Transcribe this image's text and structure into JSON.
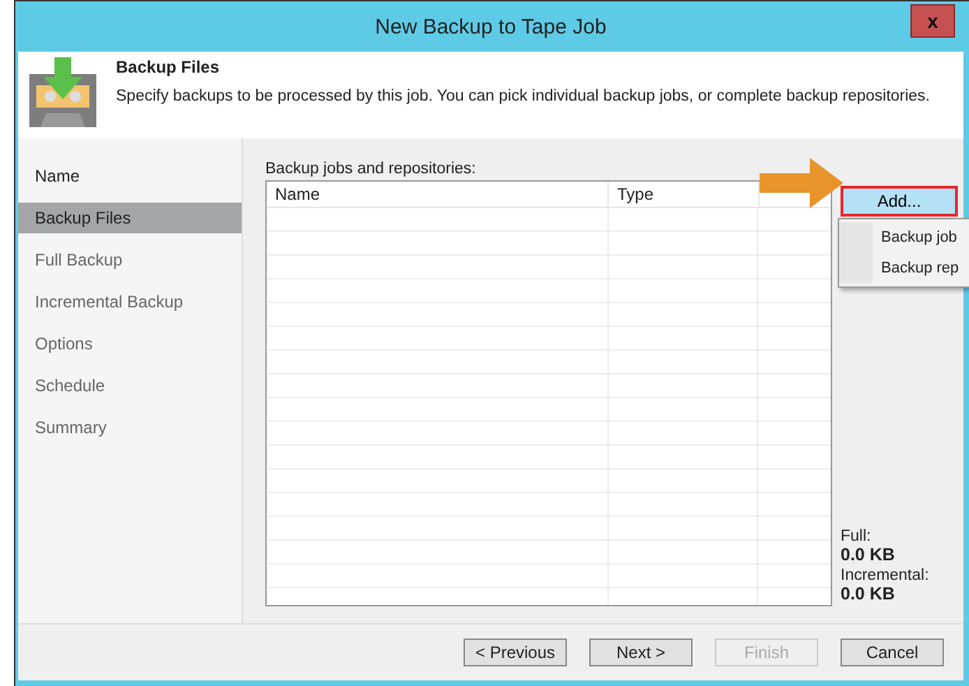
{
  "window": {
    "title": "New Backup to Tape Job",
    "close": "x"
  },
  "header": {
    "title": "Backup Files",
    "description": "Specify backups to be processed by this job. You can pick individual backup jobs, or complete backup repositories."
  },
  "sidebar": {
    "items": [
      {
        "label": "Name",
        "selected": false
      },
      {
        "label": "Backup Files",
        "selected": true
      },
      {
        "label": "Full Backup",
        "selected": false
      },
      {
        "label": "Incremental Backup",
        "selected": false
      },
      {
        "label": "Options",
        "selected": false
      },
      {
        "label": "Schedule",
        "selected": false
      },
      {
        "label": "Summary",
        "selected": false
      }
    ]
  },
  "table": {
    "label": "Backup jobs and repositories:",
    "columns": [
      "Name",
      "Type"
    ]
  },
  "add_button": {
    "label": "Add...",
    "highlighted": true
  },
  "add_menu": {
    "items": [
      "Backup job",
      "Backup rep"
    ]
  },
  "totals": [
    {
      "label": "Full:",
      "value": "0.0 KB"
    },
    {
      "label": "Incremental:",
      "value": "0.0 KB"
    }
  ],
  "buttons": [
    {
      "label": "< Previous",
      "disabled": false
    },
    {
      "label": "Next >",
      "disabled": false
    },
    {
      "label": "Finish",
      "disabled": true
    },
    {
      "label": "Cancel",
      "disabled": false
    }
  ]
}
